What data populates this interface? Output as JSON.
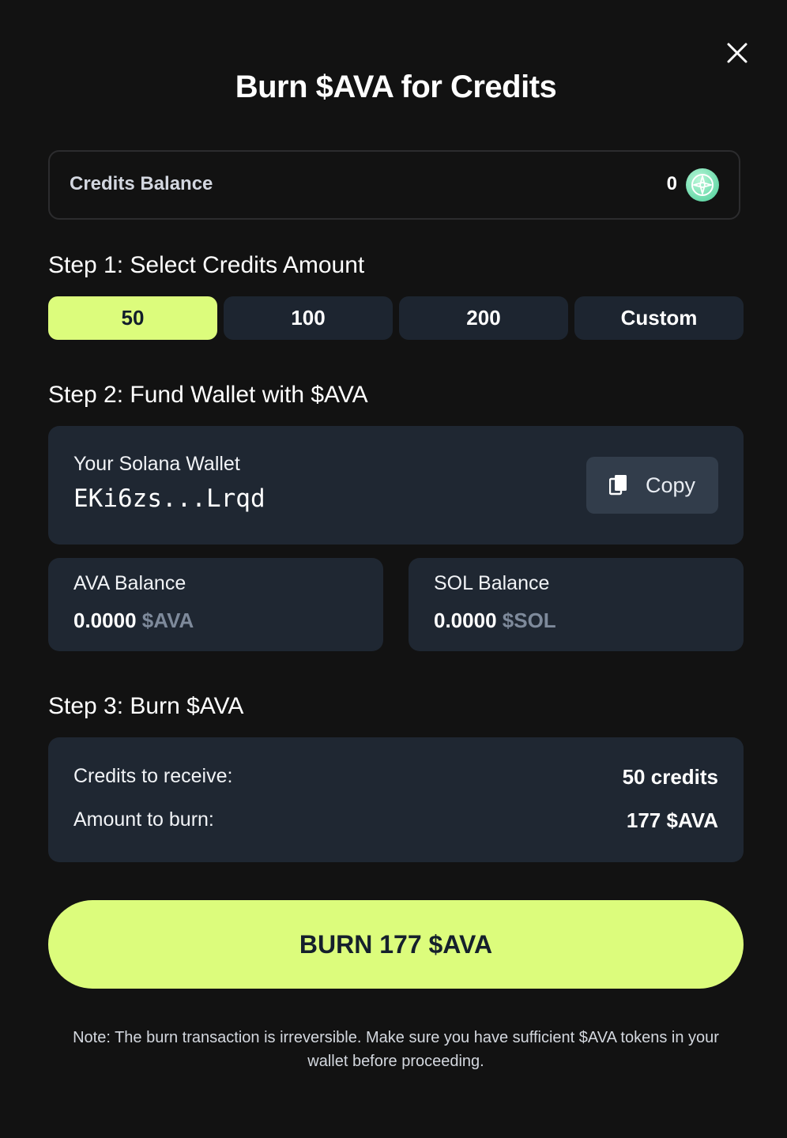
{
  "modal": {
    "title": "Burn $AVA for Credits",
    "close_icon": "close-icon"
  },
  "credits_balance": {
    "label": "Credits Balance",
    "value": "0",
    "icon": "credit-token-icon"
  },
  "step1": {
    "heading": "Step 1: Select Credits Amount",
    "options": [
      "50",
      "100",
      "200",
      "Custom"
    ],
    "selected": "50"
  },
  "step2": {
    "heading": "Step 2: Fund Wallet with $AVA",
    "wallet": {
      "label": "Your Solana Wallet",
      "address": "EKi6zs...Lrqd",
      "copy_label": "Copy",
      "copy_icon": "copy-icon"
    },
    "ava_balance": {
      "label": "AVA Balance",
      "amount": "0.0000",
      "unit": "$AVA"
    },
    "sol_balance": {
      "label": "SOL Balance",
      "amount": "0.0000",
      "unit": "$SOL"
    }
  },
  "step3": {
    "heading": "Step 3: Burn $AVA",
    "credits_label": "Credits to receive:",
    "credits_value": "50 credits",
    "burn_label": "Amount to burn:",
    "burn_value": "177 $AVA"
  },
  "burn_button": {
    "label": "BURN 177 $AVA"
  },
  "note": "Note: The burn transaction is irreversible. Make sure you have sufficient $AVA tokens in your wallet before proceeding.",
  "colors": {
    "background": "#121212",
    "accent": "#dcfc7c",
    "panel": "#1f2732",
    "button_dark": "#1d2530",
    "muted_unit": "#7e8a9b"
  }
}
